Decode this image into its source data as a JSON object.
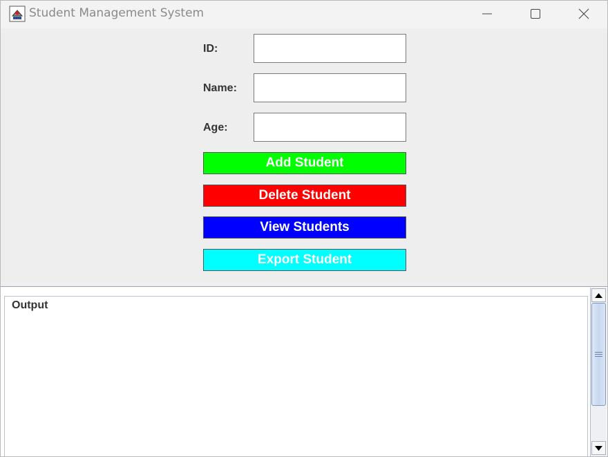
{
  "window": {
    "title": "Student Management System",
    "icons": {
      "app": "java-cup-icon",
      "minimize": "minimize-icon",
      "maximize": "maximize-icon",
      "close": "close-icon"
    }
  },
  "form": {
    "id_label": "ID:",
    "id_value": "",
    "name_label": "Name:",
    "name_value": "",
    "age_label": "Age:",
    "age_value": ""
  },
  "buttons": {
    "add": {
      "label": "Add Student",
      "color": "#00ff00"
    },
    "delete": {
      "label": "Delete Student",
      "color": "#ff0000"
    },
    "view": {
      "label": "View Students",
      "color": "#0000ff"
    },
    "export": {
      "label": "Export Student",
      "color": "#00ffff"
    }
  },
  "output": {
    "title": "Output",
    "text": ""
  }
}
